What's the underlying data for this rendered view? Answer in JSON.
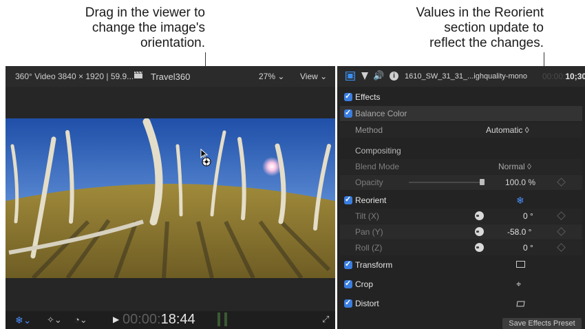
{
  "callouts": {
    "left": "Drag in the viewer to\nchange the image's\norientation.",
    "right": "Values in the Reorient\nsection update to\nreflect the changes."
  },
  "viewer": {
    "format": "360° Video 3840 × 1920 | 59.9...",
    "clapper_icon": "clapperboard-icon",
    "project_name": "Travel360",
    "zoom": "27% ⌄",
    "view_menu": "View ⌄",
    "timecode_dim": "00:00:",
    "timecode": "18:44",
    "tools": {
      "reorient_menu": "reorient-menu-icon",
      "transform_menu": "transform-tools-icon",
      "speed_menu": "speed-icon",
      "play": "play-icon",
      "fullscreen": "fullscreen-icon"
    }
  },
  "inspector": {
    "clip_name": "1610_SW_31_31_...ighquality-mono",
    "timecode_dim": "00:00:",
    "timecode": "10;30",
    "effects_header": "Effects",
    "balance_color": "Balance Color",
    "method_label": "Method",
    "method_value": "Automatic ◊",
    "compositing": "Compositing",
    "blend_mode_label": "Blend Mode",
    "blend_mode_value": "Normal ◊",
    "opacity_label": "Opacity",
    "opacity_value": "100.0 %",
    "opacity_level": 1.0,
    "reorient": "Reorient",
    "tilt_label": "Tilt (X)",
    "tilt_value": "0 °",
    "pan_label": "Pan (Y)",
    "pan_value": "-58.0 °",
    "roll_label": "Roll (Z)",
    "roll_value": "0 °",
    "transform": "Transform",
    "crop": "Crop",
    "distort": "Distort",
    "save_preset": "Save Effects Preset",
    "icons": {
      "video": "video-inspector-icon",
      "color": "color-inspector-icon",
      "audio": "audio-inspector-icon",
      "info": "info-inspector-icon"
    }
  },
  "colors": {
    "accent": "#3a7ee0",
    "panel": "#232323"
  }
}
